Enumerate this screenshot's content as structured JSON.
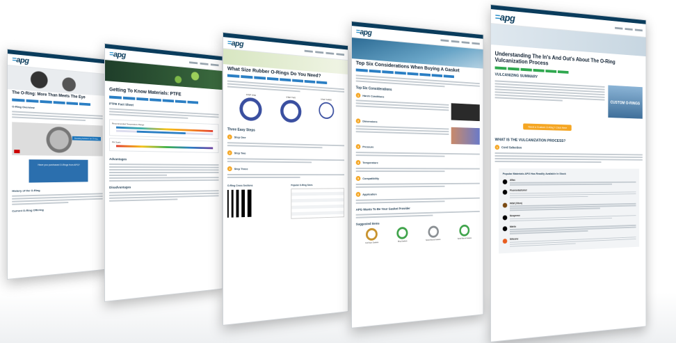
{
  "brand": {
    "logo_text": "apg",
    "colors": {
      "navy": "#0a3c5c",
      "accent": "#2a8fc9",
      "orange": "#f5a623",
      "green": "#2fa84f"
    }
  },
  "pages": [
    {
      "title": "The O-Ring: More Than Meets The Eye",
      "section": "O-Ring Overview",
      "video_caption": "Deciding between an O-ring...",
      "cta_text": "Have you purchased O-Rings from APG?",
      "section2": "History of the O-Ring",
      "section3": "Current O-Ring Offering"
    },
    {
      "title": "Getting To Know Materials: PTFE",
      "section": "PTFE Fact Sheet",
      "chart_label": "Recommended Temperature Range",
      "scale_label": "PH Scale",
      "section2": "Advantages",
      "section3": "Disadvantages"
    },
    {
      "title": "What Size Rubber O-Rings Do You Need?",
      "steps": [
        "STEP ONE",
        "STEP TWO",
        "STEP THREE"
      ],
      "section": "Three Easy Steps",
      "step_labels": [
        "Step One",
        "Step Two",
        "Step Three"
      ],
      "cross_sections": "O-Ring Cross Sections",
      "sizes_table": "Popular O-Ring Sizes"
    },
    {
      "title": "Top Six Considerations When Buying A Gasket",
      "section": "Top Six Considerations",
      "items": [
        "Harsh Conditions",
        "Dimensions",
        "Pressure",
        "Temperature",
        "Compatibility",
        "Application"
      ],
      "cta": "APG Wants To Be Your Gasket Provider",
      "suggested": "Suggested Items",
      "suggested_items": [
        "Full Face Gaskets",
        "Ring Gaskets",
        "Spiral Wound Gaskets",
        "Spiral Wound Gaskets"
      ]
    },
    {
      "title": "Understanding The In's And Out's About The O-Ring Vulcanization Process",
      "summary_heading": "VULCANIZING SUMMARY",
      "promo_title": "CUSTOM O-RINGS",
      "cta_button": "Need a Custom O-Ring? Click Here",
      "process_heading": "WHAT IS THE VULCANIZATION PROCESS?",
      "step_heading": "Cord Selection",
      "materials_heading": "Popular Materials APG Has Readily Available In Stock",
      "materials": [
        {
          "name": "Aflas",
          "color": "#000000"
        },
        {
          "name": "Fluoroelastomer",
          "color": "#000000"
        },
        {
          "name": "FKM (Viton)",
          "color": "#7a4a12"
        },
        {
          "name": "Neoprene",
          "color": "#000000"
        },
        {
          "name": "Nitrile",
          "color": "#000000"
        },
        {
          "name": "Silicone",
          "color": "#e85d1f"
        }
      ]
    }
  ]
}
